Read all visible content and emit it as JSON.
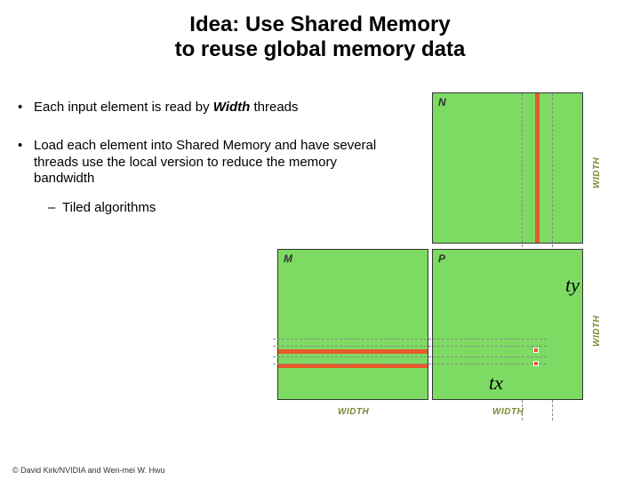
{
  "title_line1": "Idea: Use Shared Memory",
  "title_line2": "to reuse global memory data",
  "bullets": {
    "b1_pre": "Each input element is read by ",
    "b1_em": "Width",
    "b1_post": " threads",
    "b2": "Load each element into Shared Memory and have several threads use the local version to reduce the memory bandwidth",
    "b2_sub": "Tiled algorithms"
  },
  "labels": {
    "N": "N",
    "M": "M",
    "P": "P",
    "W": "WIDTH",
    "tx": "tx",
    "ty": "ty"
  },
  "footer": "© David Kirk/NVIDIA and Wen-mei W. Hwu"
}
